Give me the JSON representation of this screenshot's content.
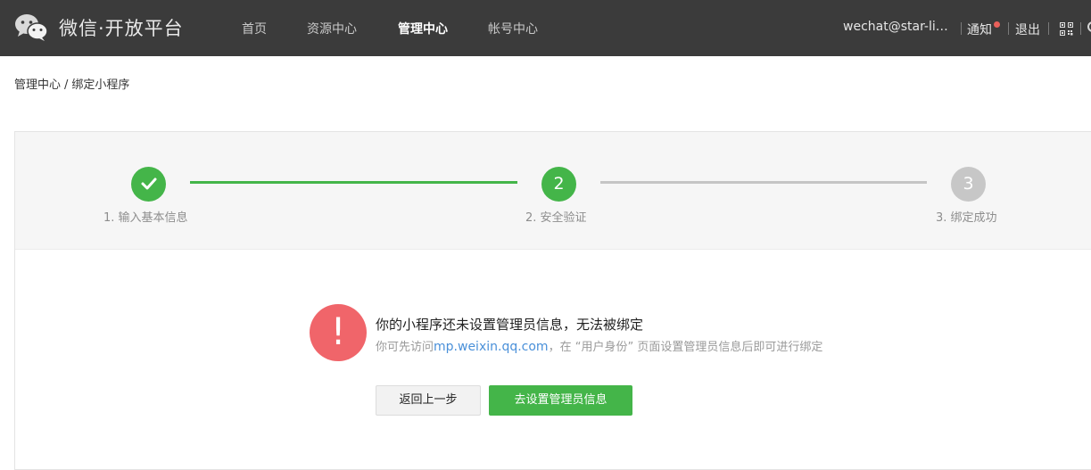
{
  "header": {
    "brand": "微信·开放平台",
    "logo_icon": "wechat-logo-icon",
    "nav": [
      {
        "label": "首页",
        "active": false
      },
      {
        "label": "资源中心",
        "active": false
      },
      {
        "label": "管理中心",
        "active": true
      },
      {
        "label": "帐号中心",
        "active": false
      }
    ],
    "account": "wechat@star-livi...",
    "notify_label": "通知",
    "notify_dot_color": "#e9605a",
    "logout_label": "退出",
    "qr_icon": "qr-code-icon",
    "bg_color": "#3b3b3b"
  },
  "breadcrumb": {
    "parent": "管理中心",
    "separator": "/",
    "current": "绑定小程序"
  },
  "steps": [
    {
      "label": "1. 输入基本信息",
      "marker": "",
      "state": "done",
      "icon": "check-icon"
    },
    {
      "label": "2. 安全验证",
      "marker": "2",
      "state": "current"
    },
    {
      "label": "3. 绑定成功",
      "marker": "3",
      "state": "todo"
    }
  ],
  "message": {
    "icon": "exclamation-icon",
    "icon_glyph": "!",
    "title": "你的小程序还未设置管理员信息，无法被绑定",
    "desc_prefix": "你可先访问",
    "desc_link": "mp.weixin.qq.com",
    "desc_suffix": "，在 “用户身份” 页面设置管理员信息后即可进行绑定"
  },
  "buttons": {
    "back_label": "返回上一步",
    "primary_label": "去设置管理员信息"
  },
  "colors": {
    "accent_green": "#44b549",
    "warning_red": "#f0656a",
    "link_blue": "#4a90d9",
    "step_todo_gray": "#c7c7c7"
  }
}
